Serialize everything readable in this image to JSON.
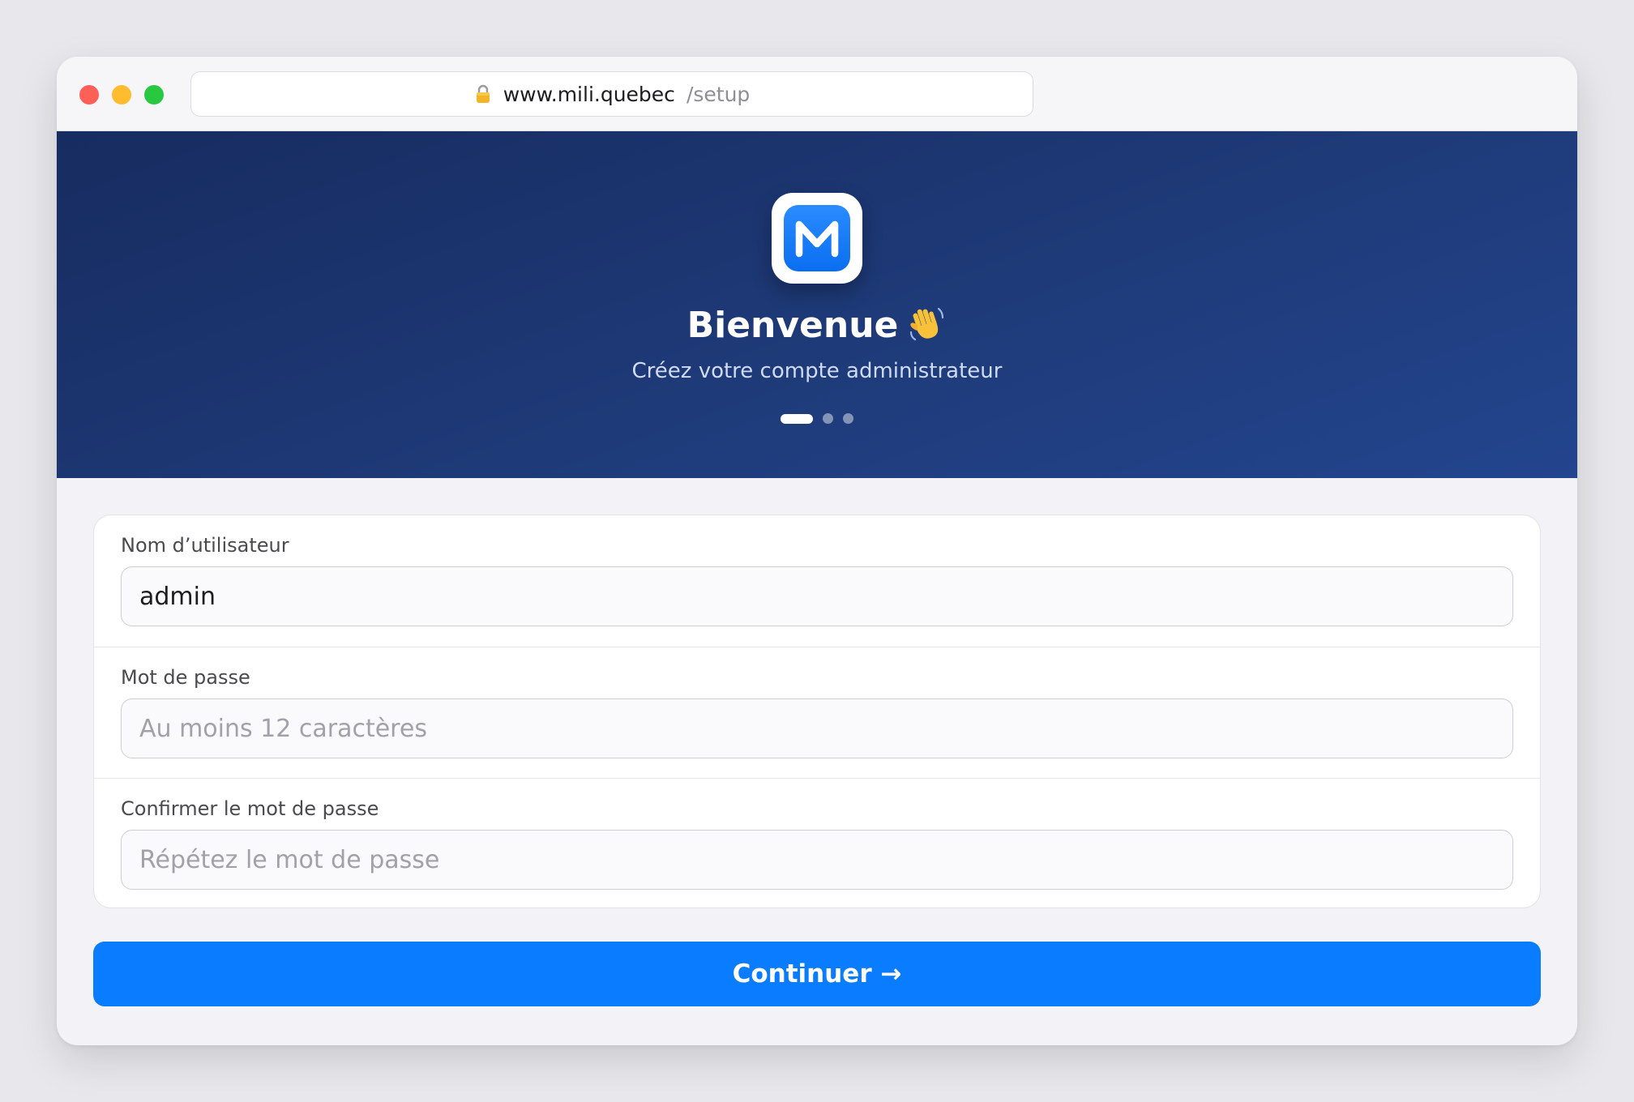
{
  "browser": {
    "url_domain": "www.mili.quebec",
    "url_path": "/setup"
  },
  "hero": {
    "logo_letter": "M",
    "title": "Bienvenue",
    "title_icon": "waving-hand-icon",
    "subtitle": "Créez votre compte administrateur",
    "steps_total": 3,
    "step_current": 1
  },
  "form": {
    "username": {
      "label": "Nom d’utilisateur",
      "value": "admin",
      "placeholder": ""
    },
    "password": {
      "label": "Mot de passe",
      "value": "",
      "placeholder": "Au moins 12 caractères"
    },
    "confirm_password": {
      "label": "Confirmer le mot de passe",
      "value": "",
      "placeholder": "Répétez le mot de passe"
    }
  },
  "actions": {
    "continue_label": "Continuer →"
  },
  "colors": {
    "accent": "#0a7cff",
    "hero_start": "#172c60",
    "hero_end": "#23458e"
  }
}
